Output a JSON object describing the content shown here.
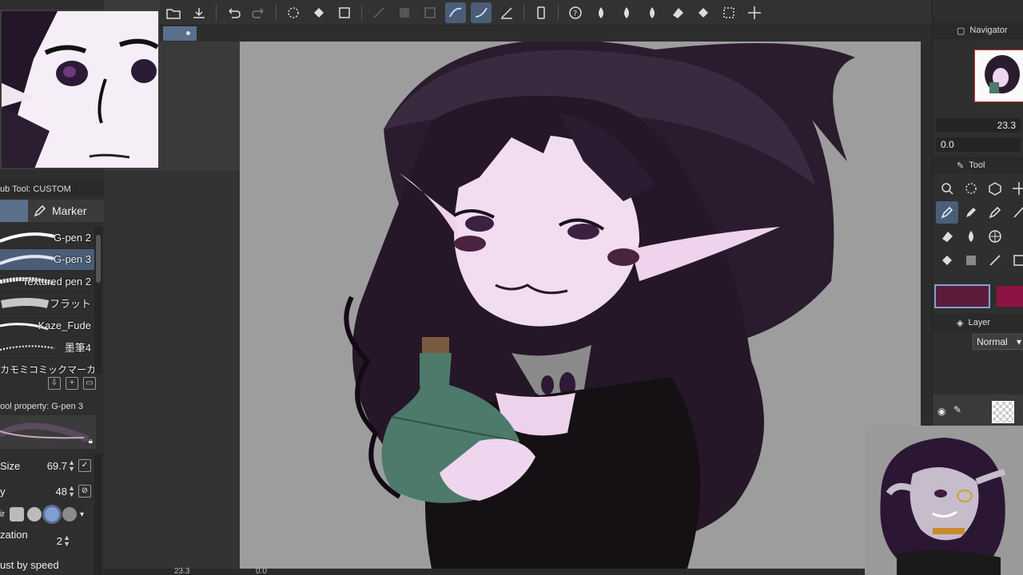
{
  "left": {
    "subtool_header": "ub Tool: CUSTOM",
    "marker_tab": "Marker",
    "brushes": [
      {
        "label": "G-pen 2",
        "selected": false
      },
      {
        "label": "G-pen 3",
        "selected": true
      },
      {
        "label": "Textured pen 2",
        "selected": false
      },
      {
        "label": "フラット",
        "selected": false
      },
      {
        "label": "Kaze_Fude",
        "selected": false
      },
      {
        "label": "墨筆4",
        "selected": false
      },
      {
        "label": "カモミコミックマーカー",
        "selected": false
      }
    ],
    "property_header": "ool property: G-pen 3",
    "size_label": "Size",
    "size_value": "69.7",
    "opacity_label": "y",
    "opacity_value": "48",
    "tip_label": "ir",
    "stab_label": "zation",
    "stab_value": "2",
    "speed_label": "ust by speed"
  },
  "right": {
    "navigator_title": "Navigator",
    "zoom_value": "23.3",
    "rotate_value": "0.0",
    "tool_title": "Tool",
    "layer_title": "Layer",
    "blend_mode": "Normal",
    "main_color": "#5c1d3a",
    "sub_color": "#8e1243"
  },
  "bottom": {
    "zoom_readout": "23.3",
    "angle_readout": "0.0"
  }
}
